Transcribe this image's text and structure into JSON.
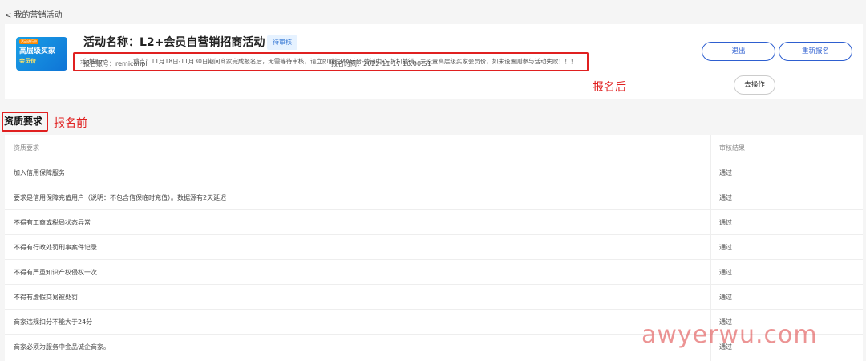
{
  "nav": {
    "back_label": "< 我的营销活动"
  },
  "activity": {
    "banner": {
      "tag": "活动进行中",
      "line1": "高层级买家",
      "line2": "会员价"
    },
    "title": "活动名称：L2+会员自营销招商活动",
    "status": "待审核",
    "account": "报名账号：remicahpl",
    "time": "报名时间：2022-11-17 16:00:51",
    "tip_label": "活动提示：",
    "tip_text": "重点：11月18日-11月30日期间商家完成报名后，无需等待审核，请立即前往MA后台-营销中心-折扣营销，去设置高层级买家会员价，如未设置则参与活动失败！！！",
    "buttons": {
      "exit": "退出",
      "reapply": "重新报名",
      "operate": "去操作"
    }
  },
  "annotations": {
    "after": "报名后",
    "before": "报名前"
  },
  "qualification": {
    "section_title": "资质要求",
    "headers": {
      "requirement": "资质要求",
      "result": "审核结果"
    },
    "rows": [
      {
        "requirement": "加入信用保障服务",
        "result": "通过"
      },
      {
        "requirement": "要求是信用保障充值用户（说明：不包含信保临时充值）。数据源有2天延迟",
        "result": "通过"
      },
      {
        "requirement": "不得有工商或税局状态异常",
        "result": "通过"
      },
      {
        "requirement": "不得有行政处罚刑事案件记录",
        "result": "通过"
      },
      {
        "requirement": "不得有严重知识产权侵权一次",
        "result": "通过"
      },
      {
        "requirement": "不得有虚假交易被处罚",
        "result": "通过"
      },
      {
        "requirement": "商家违规扣分不能大于24分",
        "result": "通过"
      },
      {
        "requirement": "商家必须为服务中金品诚企商家。",
        "result": "通过"
      }
    ]
  },
  "watermark": "awyerwu.com"
}
